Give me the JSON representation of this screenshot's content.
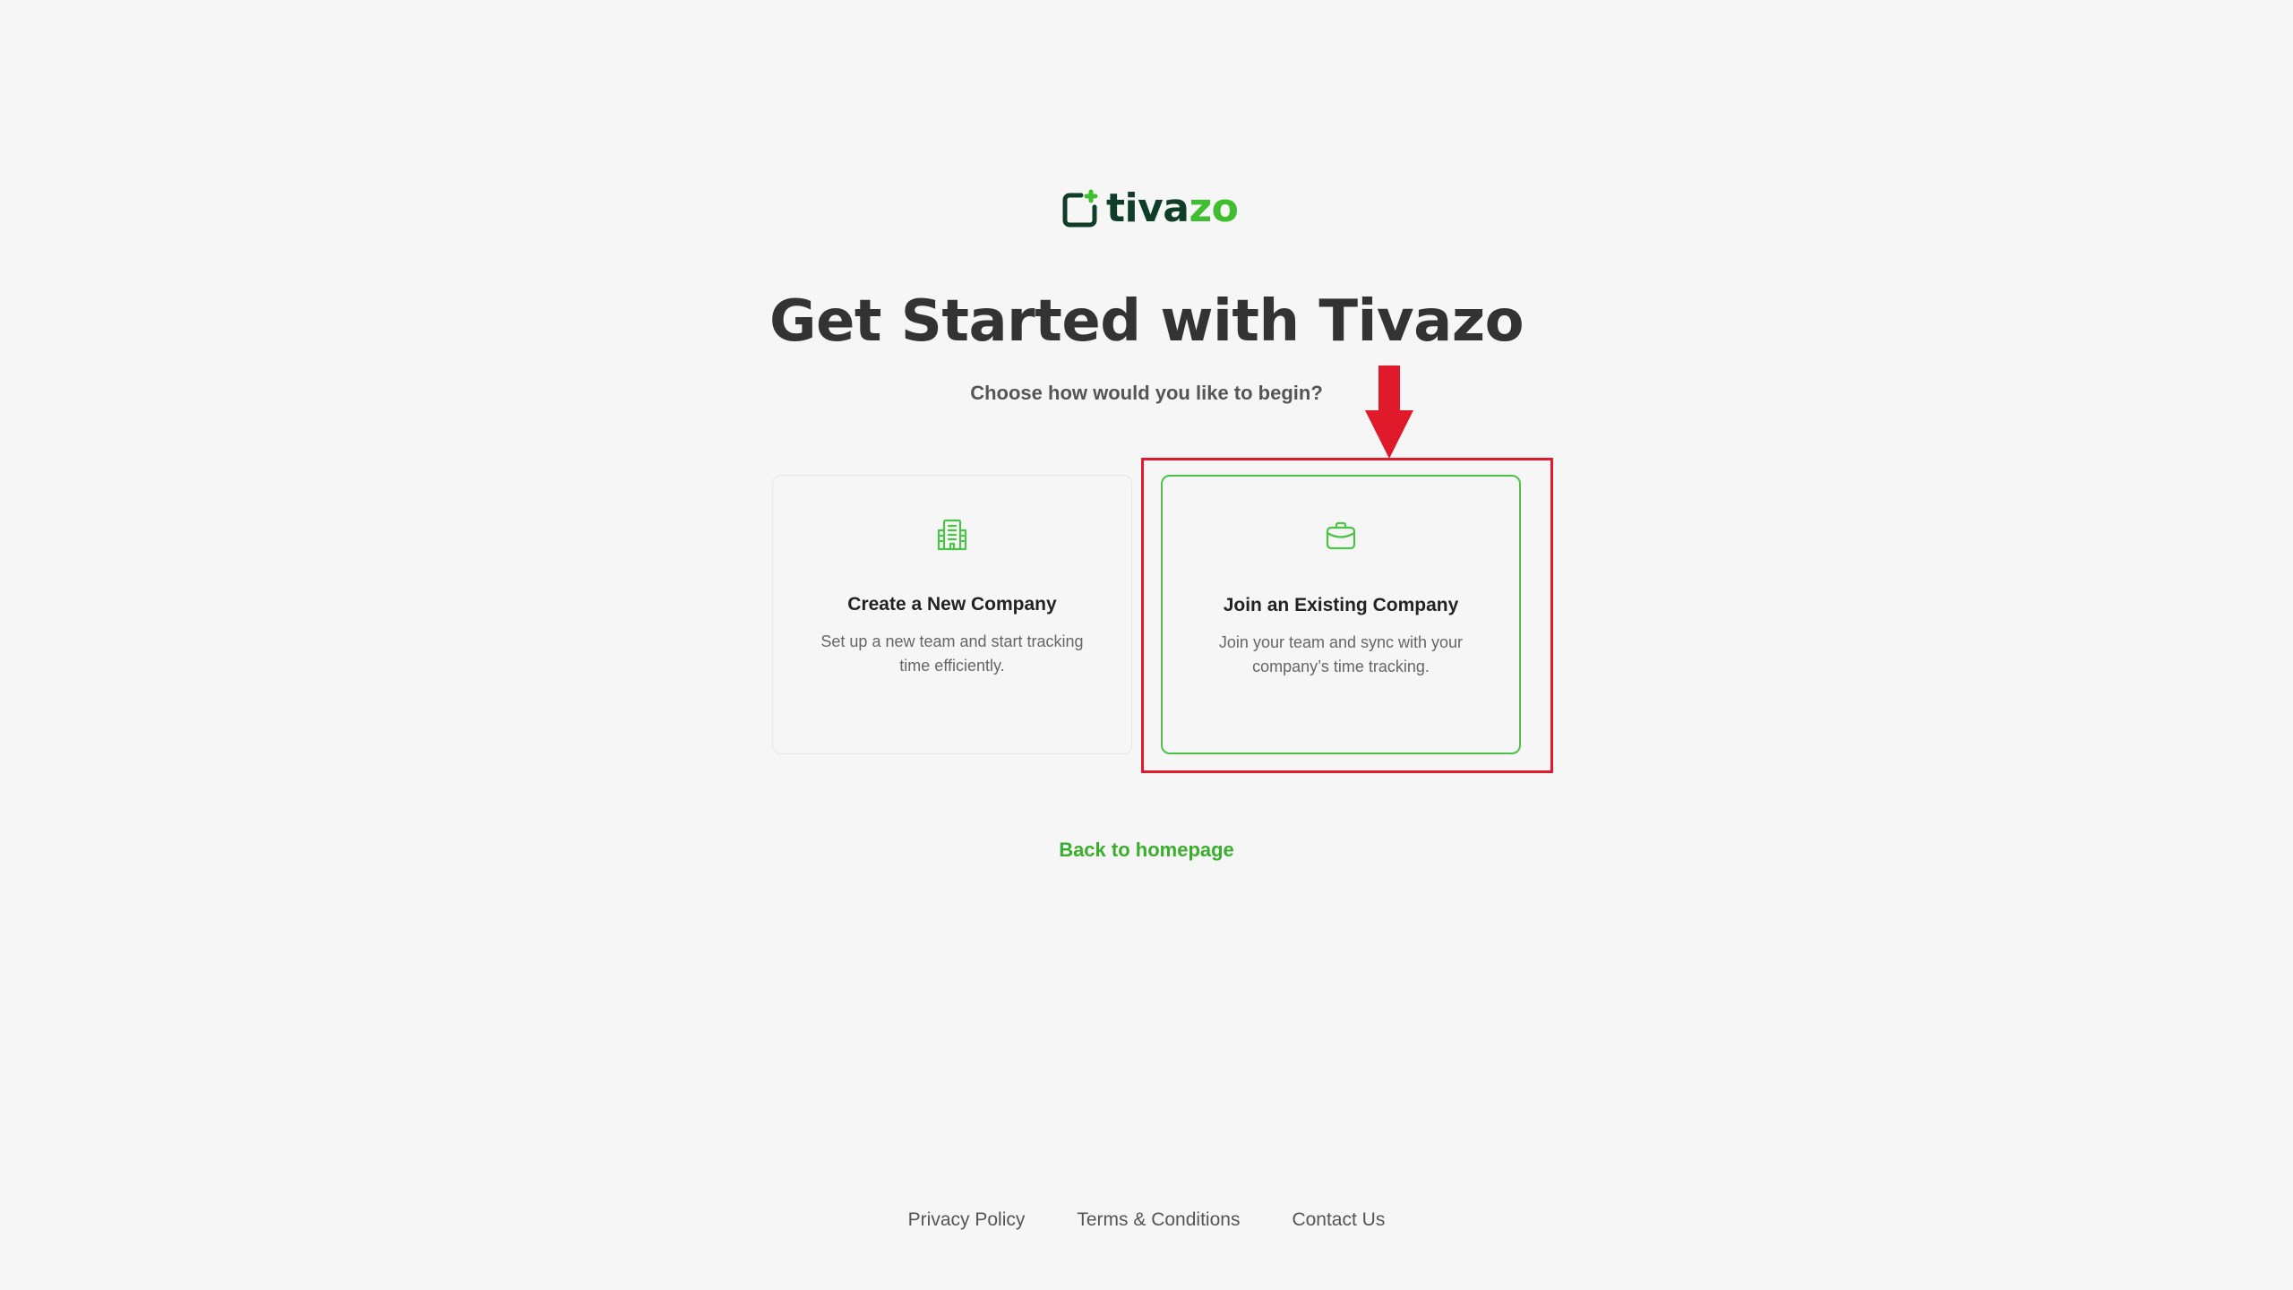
{
  "brand": {
    "name_part1": "tiva",
    "name_part2": "zo",
    "color_dark": "#0f3d27",
    "color_green": "#3fbe2f",
    "icon": "tivazo-logo-icon"
  },
  "header": {
    "title": "Get Started with Tivazo",
    "subtitle": "Choose how would you like to begin?"
  },
  "options": [
    {
      "icon": "building-icon",
      "title": "Create a New Company",
      "description": "Set up a new team and start tracking time efficiently."
    },
    {
      "icon": "briefcase-icon",
      "title": "Join an Existing Company",
      "description": "Join your team and sync with your company’s time tracking."
    }
  ],
  "back_link": "Back to homepage",
  "footer": {
    "links": [
      "Privacy Policy",
      "Terms & Conditions",
      "Contact Us"
    ]
  },
  "annotation": {
    "color": "#e11a2b",
    "target": "join-existing-company-card"
  }
}
